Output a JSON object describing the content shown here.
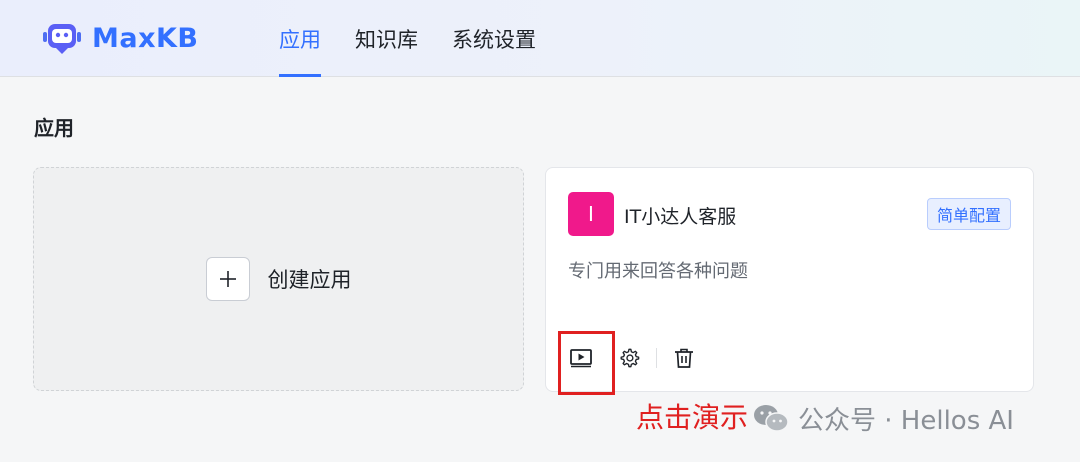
{
  "header": {
    "logo_text": "MaxKB",
    "tabs": [
      {
        "label": "应用",
        "active": true
      },
      {
        "label": "知识库",
        "active": false
      },
      {
        "label": "系统设置",
        "active": false
      }
    ]
  },
  "page": {
    "title": "应用"
  },
  "create_card": {
    "label": "创建应用"
  },
  "app_card": {
    "avatar_letter": "I",
    "avatar_color": "#f0198b",
    "name": "IT小达人客服",
    "tag": "简单配置",
    "description": "专门用来回答各种问题",
    "actions": [
      "play-icon",
      "gear-icon",
      "trash-icon"
    ]
  },
  "annotation": {
    "text": "点击演示"
  },
  "watermark": {
    "text": "公众号 · Hellos AI"
  },
  "colors": {
    "accent": "#3370ff",
    "annotation": "#e02020"
  }
}
